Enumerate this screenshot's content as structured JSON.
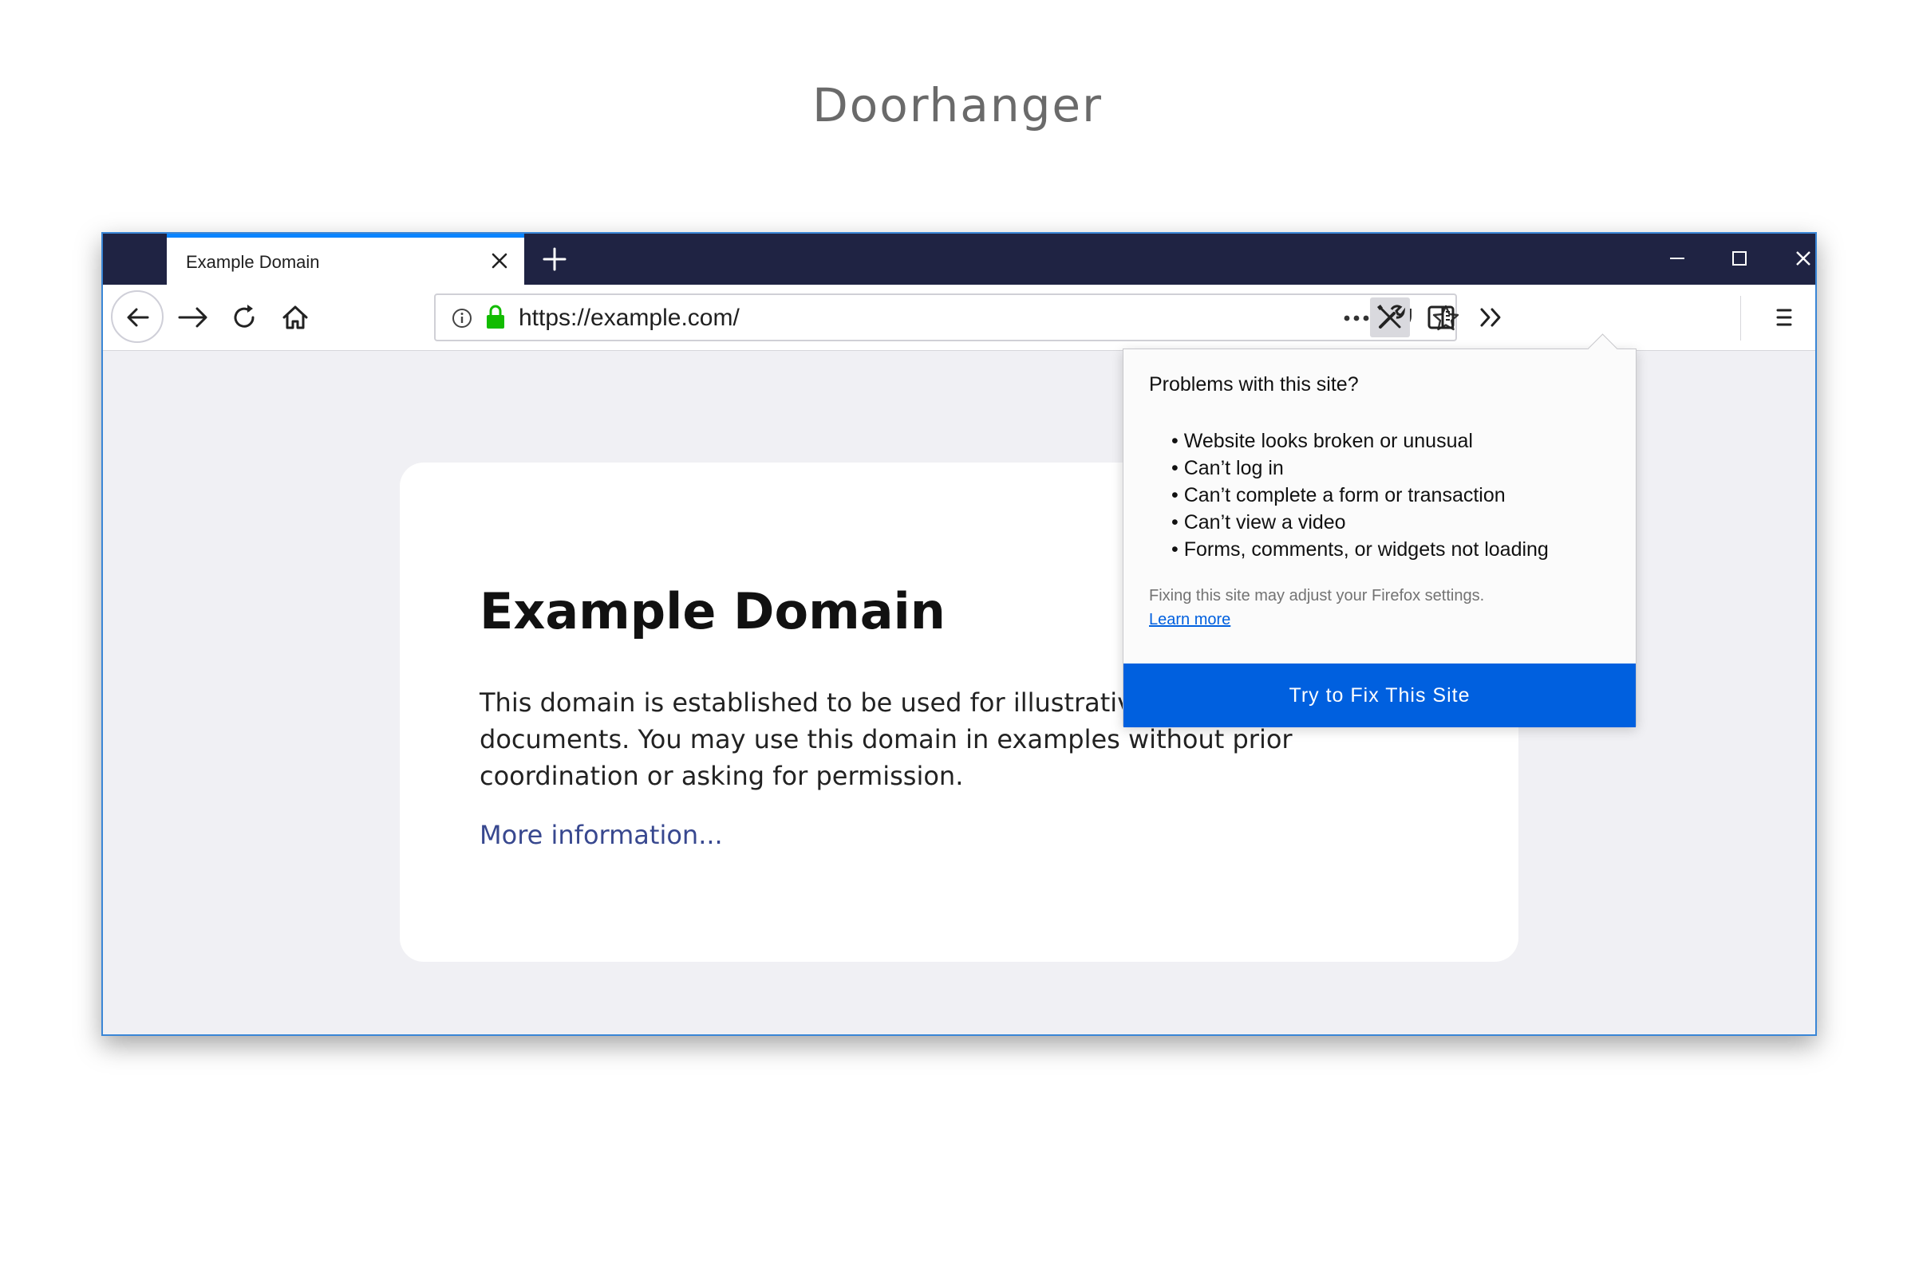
{
  "page": {
    "heading": "Doorhanger"
  },
  "browser": {
    "tab": {
      "title": "Example Domain"
    },
    "url": "https://example.com/"
  },
  "content": {
    "title": "Example Domain",
    "paragraph": "This domain is established to be used for illustrative examples in documents. You may use this domain in examples without prior coordination or asking for permission.",
    "link": "More information..."
  },
  "doorhanger": {
    "heading": "Problems with this site?",
    "issues": [
      "Website looks broken or unusual",
      "Can’t log in",
      "Can’t complete a form or transaction",
      "Can’t view a video",
      "Forms, comments, or widgets not loading"
    ],
    "note": "Fixing this site may adjust your Firefox settings.",
    "learn_more": "Learn more",
    "button": "Try to Fix This Site"
  },
  "colors": {
    "titlebar": "#1f2343",
    "accent": "#0a84ff",
    "primary_button": "#0060df",
    "secure_lock": "#12bc00",
    "window_border": "#3a86d6"
  },
  "icons": [
    "close-icon",
    "plus-icon",
    "minimize-icon",
    "maximize-icon",
    "window-close-icon",
    "back-arrow-icon",
    "forward-arrow-icon",
    "reload-icon",
    "home-icon",
    "info-icon",
    "lock-icon",
    "ellipsis-icon",
    "pocket-icon",
    "star-icon",
    "tools-icon",
    "sidebar-icon",
    "overflow-icon",
    "hamburger-menu-icon"
  ]
}
